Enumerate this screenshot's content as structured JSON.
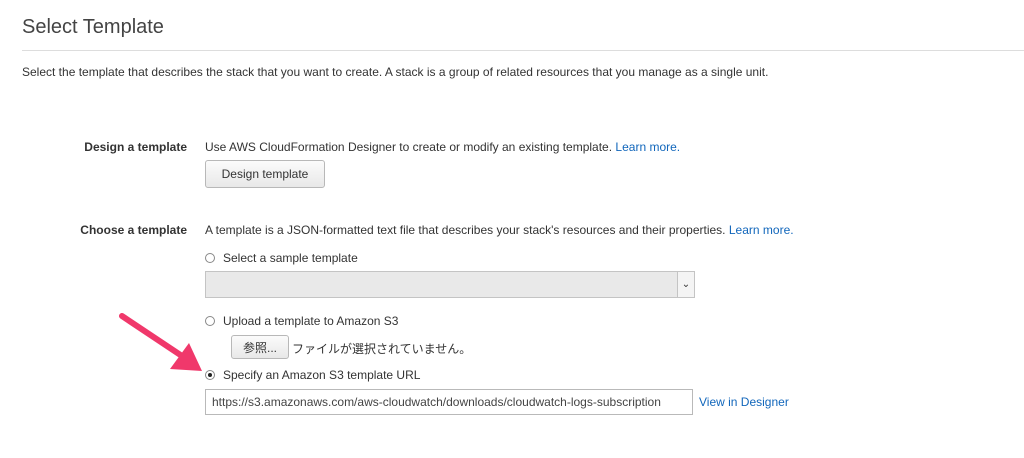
{
  "page": {
    "title": "Select Template",
    "description": "Select the template that describes the stack that you want to create. A stack is a group of related resources that you manage as a single unit."
  },
  "design_section": {
    "label": "Design a template",
    "text": "Use AWS CloudFormation Designer to create or modify an existing template.",
    "learn_more": "Learn more.",
    "button_label": "Design template"
  },
  "choose_section": {
    "label": "Choose a template",
    "text": "A template is a JSON-formatted text file that describes your stack's resources and their properties.",
    "learn_more": "Learn more.",
    "options": [
      {
        "label": "Select a sample template",
        "checked": false
      },
      {
        "label": "Upload a template to Amazon S3",
        "checked": false
      },
      {
        "label": "Specify an Amazon S3 template URL",
        "checked": true
      }
    ],
    "sample_select_value": "",
    "browse_button_label": "参照...",
    "file_status": "ファイルが選択されていません。",
    "template_url": "https://s3.amazonaws.com/aws-cloudwatch/downloads/cloudwatch-logs-subscription",
    "view_in_designer": "View in Designer"
  },
  "annotation": {
    "arrow_color": "#f0386b"
  }
}
